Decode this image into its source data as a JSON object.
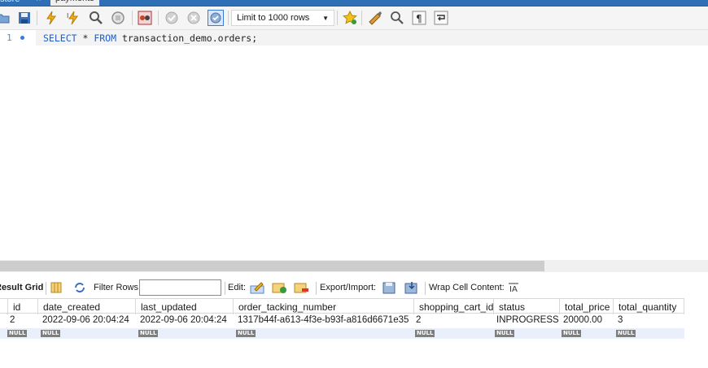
{
  "tabs": {
    "left_label": "store",
    "close_glyph": "×",
    "active_label": "payments"
  },
  "toolbar": {
    "limit_label": "Limit to 1000 rows",
    "icons": [
      "open-folder-icon",
      "save-icon",
      "execute-icon",
      "execute-current-icon",
      "explain-icon",
      "stop-icon",
      "toggle-results-icon",
      "commit-icon",
      "rollback-icon",
      "autocommit-icon",
      "limit-dropdown",
      "favorite-icon",
      "beautify-icon",
      "find-icon",
      "invisible-chars-icon",
      "wrap-icon"
    ]
  },
  "editor": {
    "line_number": "1",
    "sql": {
      "kw1": "SELECT",
      "star": " * ",
      "kw2": "FROM",
      "rest": " transaction_demo.orders;"
    }
  },
  "result_toolbar": {
    "result_grid": "Result Grid",
    "filter_rows": "Filter Rows:",
    "edit": "Edit:",
    "export_import": "Export/Import:",
    "wrap_cell": "Wrap Cell Content:",
    "filter_value": ""
  },
  "grid": {
    "columns": [
      "id",
      "date_created",
      "last_updated",
      "order_tacking_number",
      "shopping_cart_id",
      "status",
      "total_price",
      "total_quantity"
    ],
    "rows": [
      [
        "2",
        "2022-09-06 20:04:24",
        "2022-09-06 20:04:24",
        "1317b44f-a613-4f3e-b93f-a816d6671e35",
        "2",
        "INPROGRESS",
        "20000.00",
        "3"
      ]
    ],
    "null_label": "NULL"
  },
  "colors": {
    "keyword": "#1f5fc9",
    "tab_strip": "#2f6fb6",
    "null_badge": "#7e7e7e",
    "new_row": "#e9f0fb"
  }
}
